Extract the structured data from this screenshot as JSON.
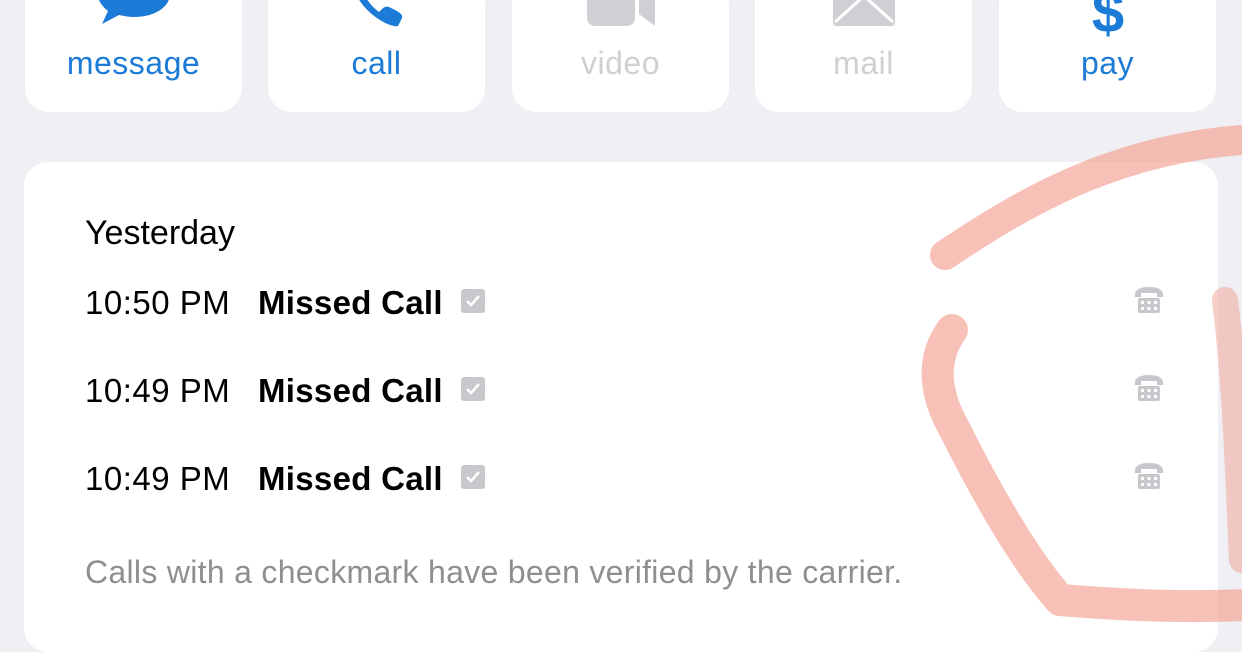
{
  "actions": [
    {
      "label": "message",
      "icon": "message-bubble-icon",
      "enabled": true
    },
    {
      "label": "call",
      "icon": "phone-icon",
      "enabled": true
    },
    {
      "label": "video",
      "icon": "video-camera-icon",
      "enabled": false
    },
    {
      "label": "mail",
      "icon": "envelope-icon",
      "enabled": false
    },
    {
      "label": "pay",
      "icon": "dollar-icon",
      "enabled": true
    }
  ],
  "recents": {
    "section_title": "Yesterday",
    "calls": [
      {
        "time": "10:50 PM",
        "type": "Missed Call",
        "verified": true
      },
      {
        "time": "10:49 PM",
        "type": "Missed Call",
        "verified": true
      },
      {
        "time": "10:49 PM",
        "type": "Missed Call",
        "verified": true
      }
    ],
    "footnote": "Calls with a checkmark have been verified by the carrier."
  },
  "colors": {
    "accent": "#1b7bd6",
    "disabled": "#d0d0d4",
    "background": "#efeff4",
    "secondary_text": "#8e8e93",
    "annotation": "#f2a090"
  }
}
